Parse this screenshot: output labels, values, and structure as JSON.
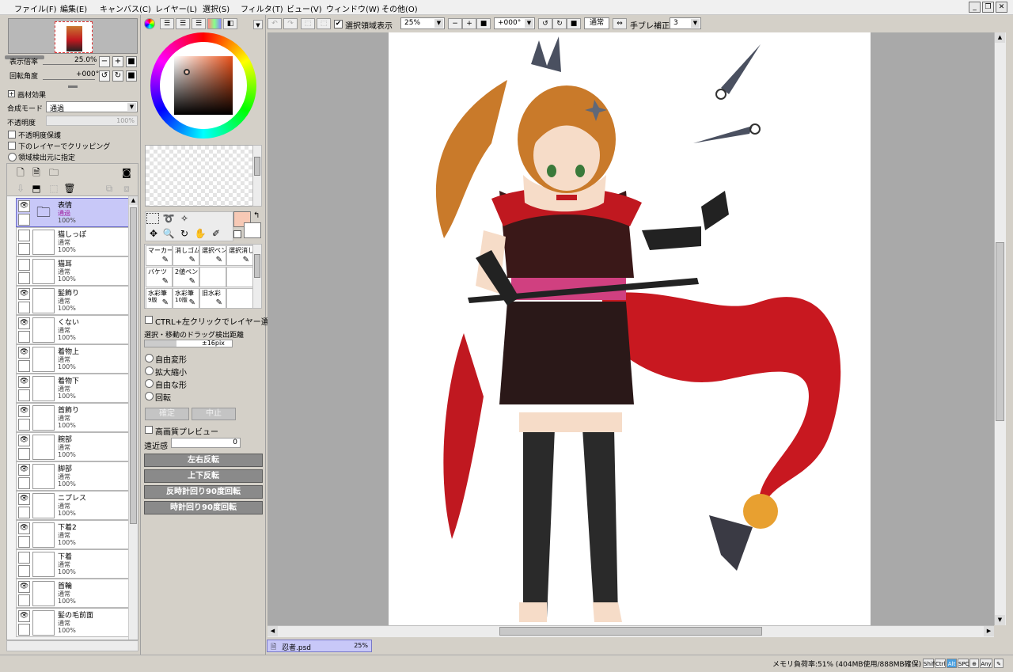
{
  "menu": [
    "ファイル(F)",
    "編集(E)",
    "キャンバス(C)",
    "レイヤー(L)",
    "選択(S)",
    "フィルタ(T)",
    "ビュー(V)",
    "ウィンドウ(W)",
    "その他(O)"
  ],
  "navigator": {
    "zoom_label": "表示倍率",
    "zoom_value": "25.0%",
    "rotate_label": "回転角度",
    "rotate_value": "+000°"
  },
  "layer_props": {
    "texture_label": "画材効果",
    "blend_label": "合成モード",
    "blend_value": "通過",
    "opacity_label": "不透明度",
    "opacity_value": "100%",
    "preserve_opacity": "不透明度保護",
    "clipping": "下のレイヤーでクリッピング",
    "selection_source": "領域検出元に指定"
  },
  "layers": [
    {
      "name": "表情",
      "mode": "通過",
      "opacity": "100%",
      "visible": true,
      "folder": true
    },
    {
      "name": "猫しっぽ",
      "mode": "通常",
      "opacity": "100%",
      "visible": false
    },
    {
      "name": "猫耳",
      "mode": "通常",
      "opacity": "100%",
      "visible": false
    },
    {
      "name": "髪飾り",
      "mode": "通常",
      "opacity": "100%",
      "visible": true
    },
    {
      "name": "くない",
      "mode": "通常",
      "opacity": "100%",
      "visible": true
    },
    {
      "name": "着物上",
      "mode": "通常",
      "opacity": "100%",
      "visible": true
    },
    {
      "name": "着物下",
      "mode": "通常",
      "opacity": "100%",
      "visible": true
    },
    {
      "name": "首飾り",
      "mode": "通常",
      "opacity": "100%",
      "visible": true
    },
    {
      "name": "腕部",
      "mode": "通常",
      "opacity": "100%",
      "visible": true
    },
    {
      "name": "脚部",
      "mode": "通常",
      "opacity": "100%",
      "visible": true
    },
    {
      "name": "ニプレス",
      "mode": "通常",
      "opacity": "100%",
      "visible": true
    },
    {
      "name": "下着2",
      "mode": "通常",
      "opacity": "100%",
      "visible": true
    },
    {
      "name": "下着",
      "mode": "通常",
      "opacity": "100%",
      "visible": false
    },
    {
      "name": "首輪",
      "mode": "通常",
      "opacity": "100%",
      "visible": true
    },
    {
      "name": "髪の毛前面",
      "mode": "通常",
      "opacity": "100%",
      "visible": true
    }
  ],
  "colors": {
    "primary": "#f7c9b5",
    "secondary": "#ffffff",
    "selected_layer": "#c8c8f8",
    "accent_red": "#c01820"
  },
  "brushes": [
    {
      "name": "マーカー"
    },
    {
      "name": "消しゴム"
    },
    {
      "name": "選択ペン"
    },
    {
      "name": "選択消し"
    },
    {
      "name": "バケツ"
    },
    {
      "name": "2値ペン"
    },
    {
      "name": ""
    },
    {
      "name": ""
    },
    {
      "name": "水彩筆",
      "sub": "9版"
    },
    {
      "name": "水彩筆",
      "sub": "10版"
    },
    {
      "name": "旧水彩"
    },
    {
      "name": ""
    }
  ],
  "tool_options": {
    "ctrl_click": "CTRL+左クリックでレイヤー選択",
    "drag_label": "選択・移動のドラッグ検出距離",
    "drag_value": "±16pix",
    "transforms": [
      "自由変形",
      "拡大縮小",
      "自由な形",
      "回転"
    ],
    "ok": "確定",
    "cancel": "中止",
    "hq_preview": "高画質プレビュー",
    "perspective_label": "遠近感",
    "perspective_value": "0",
    "flip_h": "左右反転",
    "flip_v": "上下反転",
    "rot_ccw": "反時計回り90度回転",
    "rot_cw": "時計回り90度回転"
  },
  "toolbar": {
    "show_selection": "選択領域表示",
    "zoom": "25%",
    "angle": "+000°",
    "mode": "通常",
    "stabilizer_label": "手ブレ補正",
    "stabilizer_value": "3"
  },
  "document_tab": {
    "name": "忍者.psd",
    "zoom": "25%"
  },
  "status": {
    "memory": "メモリ負荷率:51% (404MB使用/888MB確保)",
    "keys": [
      "Shift",
      "Ctrl",
      "Alt",
      "SPC",
      "⊕",
      "Any",
      "✎"
    ]
  }
}
